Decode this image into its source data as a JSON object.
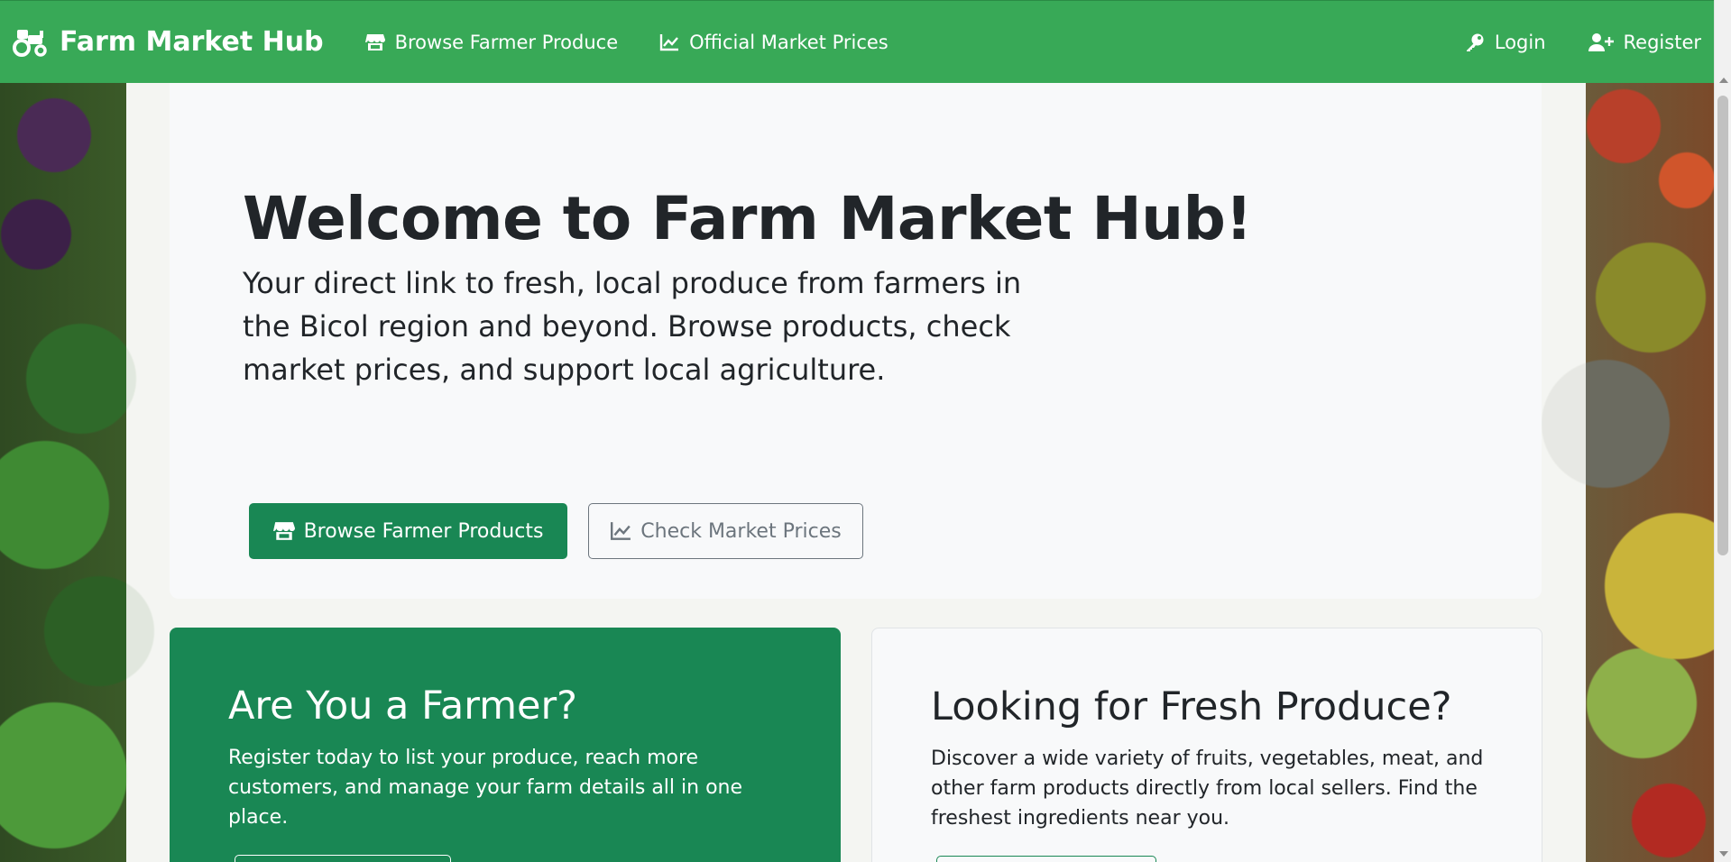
{
  "navbar": {
    "brand": "Farm Market Hub",
    "links": [
      {
        "label": "Browse Farmer Produce",
        "icon": "store-icon"
      },
      {
        "label": "Official Market Prices",
        "icon": "chart-line-icon"
      }
    ],
    "right_links": [
      {
        "label": "Login",
        "icon": "key-icon"
      },
      {
        "label": "Register",
        "icon": "user-plus-icon"
      }
    ]
  },
  "hero": {
    "title": "Welcome to Farm Market Hub!",
    "subtitle": "Your direct link to fresh, local produce from farmers in the Bicol region and beyond. Browse products, check market prices, and support local agriculture.",
    "primary_button": "Browse Farmer Products",
    "secondary_button": "Check Market Prices"
  },
  "cards": {
    "farmer": {
      "title": "Are You a Farmer?",
      "text": "Register today to list your produce, reach more customers, and manage your farm details all in one place."
    },
    "buyer": {
      "title": "Looking for Fresh Produce?",
      "text": "Discover a wide variety of fruits, vegetables, meat, and other farm products directly from local sellers. Find the freshest ingredients near you."
    }
  },
  "colors": {
    "navbar": "#38a957",
    "primary": "#198754",
    "hero_bg": "#f8f9fa",
    "text": "#212529",
    "muted": "#6c757d"
  }
}
